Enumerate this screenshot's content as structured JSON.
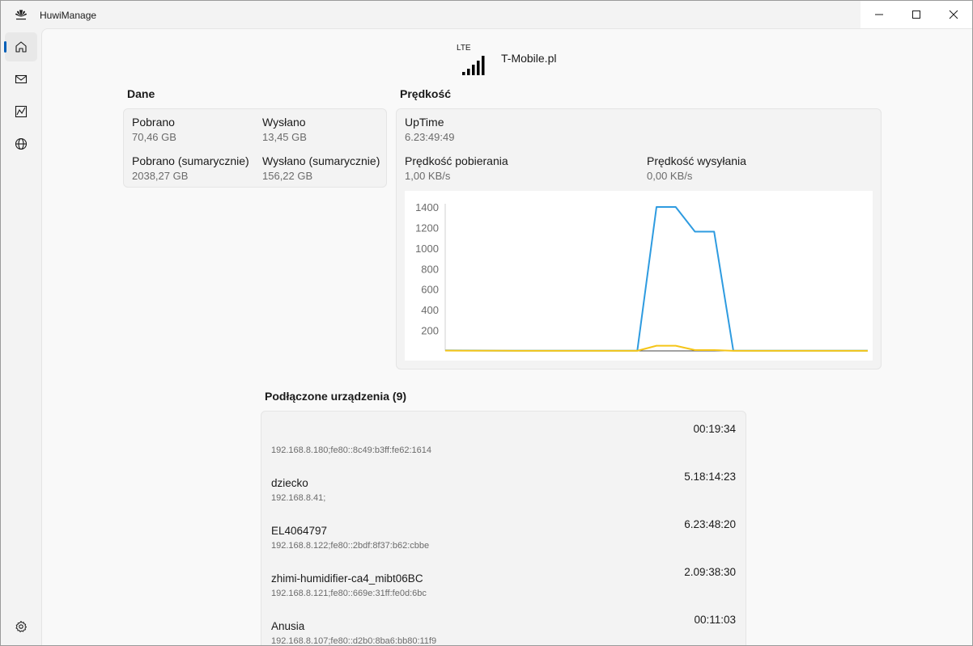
{
  "window": {
    "title": "HuwiManage"
  },
  "sidebar": {
    "items": [
      {
        "name": "home",
        "icon": "home-icon",
        "active": true
      },
      {
        "name": "messages",
        "icon": "mail-icon",
        "active": false
      },
      {
        "name": "statistics",
        "icon": "chart-icon",
        "active": false
      },
      {
        "name": "network",
        "icon": "globe-icon",
        "active": false
      }
    ],
    "settings_icon": "gear-icon"
  },
  "status": {
    "network_type": "LTE",
    "operator": "T-Mobile.pl",
    "signal_bars": 5
  },
  "data_section": {
    "title": "Dane",
    "downloaded_label": "Pobrano",
    "downloaded_value": "70,46 GB",
    "uploaded_label": "Wysłano",
    "uploaded_value": "13,45 GB",
    "downloaded_total_label": "Pobrano (sumarycznie)",
    "downloaded_total_value": "2038,27 GB",
    "uploaded_total_label": "Wysłano (sumarycznie)",
    "uploaded_total_value": "156,22 GB"
  },
  "speed_section": {
    "title": "Prędkość",
    "uptime_label": "UpTime",
    "uptime_value": "6.23:49:49",
    "download_speed_label": "Prędkość pobierania",
    "download_speed_value": "1,00 KB/s",
    "upload_speed_label": "Prędkość wysyłania",
    "upload_speed_value": "0,00 KB/s"
  },
  "chart_data": {
    "type": "line",
    "ylim": [
      0,
      1400
    ],
    "yticks": [
      "1400",
      "1200",
      "1000",
      "800",
      "600",
      "400",
      "200"
    ],
    "x": [
      0,
      1,
      2,
      3,
      4,
      5,
      6,
      7,
      8,
      9,
      10,
      11,
      12,
      13,
      14,
      15,
      16,
      17,
      18,
      19,
      20,
      21,
      22
    ],
    "series": [
      {
        "color": "#2e9be0",
        "values": [
          5,
          4,
          3,
          2,
          2,
          2,
          2,
          2,
          2,
          2,
          2,
          1400,
          1400,
          1160,
          1160,
          3,
          2,
          2,
          2,
          2,
          2,
          2,
          2
        ]
      },
      {
        "color": "#f5c518",
        "values": [
          3,
          2,
          2,
          2,
          1,
          1,
          1,
          1,
          1,
          1,
          1,
          50,
          50,
          8,
          8,
          1,
          1,
          1,
          1,
          1,
          1,
          1,
          1
        ]
      }
    ],
    "grid": false
  },
  "devices": {
    "title": "Podłączone urządzenia (9)",
    "items": [
      {
        "name": "",
        "ip": "192.168.8.180;fe80::8c49:b3ff:fe62:1614",
        "time": "00:19:34"
      },
      {
        "name": "dziecko",
        "ip": "192.168.8.41;",
        "time": "5.18:14:23"
      },
      {
        "name": "EL4064797",
        "ip": "192.168.8.122;fe80::2bdf:8f37:b62:cbbe",
        "time": "6.23:48:20"
      },
      {
        "name": "zhimi-humidifier-ca4_mibt06BC",
        "ip": "192.168.8.121;fe80::669e:31ff:fe0d:6bc",
        "time": "2.09:38:30"
      },
      {
        "name": "Anusia",
        "ip": "192.168.8.107;fe80::d2b0:8ba6:bb80:11f9",
        "time": "00:11:03"
      }
    ]
  }
}
